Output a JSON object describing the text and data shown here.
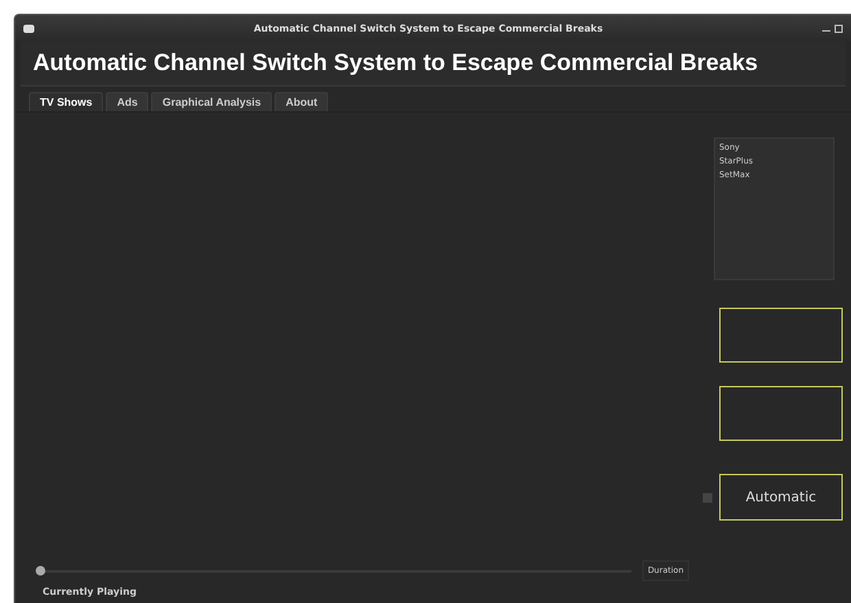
{
  "window": {
    "title": "Automatic Channel Switch System to Escape Commercial Breaks"
  },
  "header": {
    "title": "Automatic Channel Switch System to Escape Commercial Breaks"
  },
  "tabs": [
    {
      "label": "TV Shows",
      "selected": true
    },
    {
      "label": "Ads",
      "selected": false
    },
    {
      "label": "Graphical Analysis",
      "selected": false
    },
    {
      "label": "About",
      "selected": false
    }
  ],
  "channels": [
    {
      "name": "Sony"
    },
    {
      "name": "StarPlus"
    },
    {
      "name": "SetMax"
    }
  ],
  "automatic": {
    "label": "Automatic",
    "checked": false
  },
  "seek": {
    "level": 0,
    "duration": "Duration"
  },
  "status": "Currently Playing"
}
